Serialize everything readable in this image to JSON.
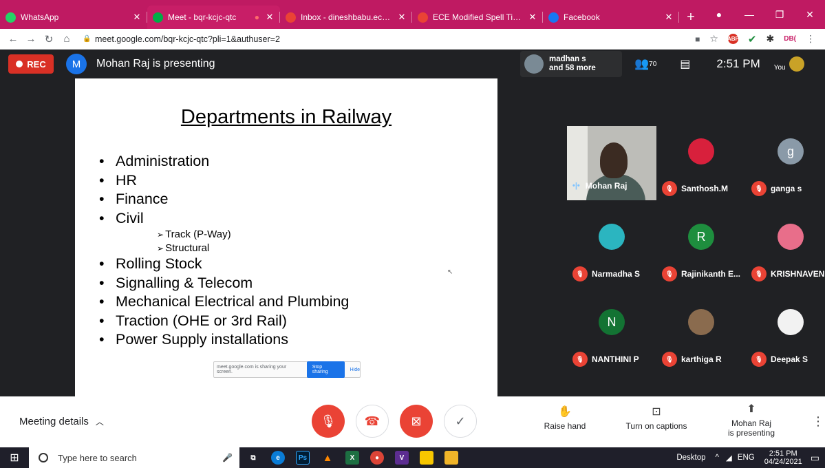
{
  "tabs": [
    {
      "label": "WhatsApp",
      "icon": "whatsapp-icon",
      "color": "#25d366"
    },
    {
      "label": "Meet - bqr-kcjc-qtc",
      "icon": "meet-icon",
      "color": "#00ac47"
    },
    {
      "label": "Inbox - dineshbabu.ece@adh",
      "icon": "gmail-icon",
      "color": "#ea4335"
    },
    {
      "label": "ECE Modified Spell Time Tabl",
      "icon": "gmail-icon",
      "color": "#ea4335"
    },
    {
      "label": "Facebook",
      "icon": "facebook-icon",
      "color": "#1877f2"
    }
  ],
  "address": {
    "url": "meet.google.com/bqr-kcjc-qtc?pli=1&authuser=2"
  },
  "meet": {
    "rec_label": "REC",
    "presenter_initial": "M",
    "presenting_text": "Mohan Raj is presenting",
    "participants_line1": "madhan s",
    "participants_line2": "and 58 more",
    "people_count": "70",
    "time": "2:51 PM",
    "you_label": "You"
  },
  "slide": {
    "title": "Departments in Railway",
    "items": [
      {
        "text": "Administration",
        "level": 1
      },
      {
        "text": "HR",
        "level": 1
      },
      {
        "text": "Finance",
        "level": 1
      },
      {
        "text": "Civil",
        "level": 1
      },
      {
        "text": "Track (P-Way)",
        "level": 2
      },
      {
        "text": "Structural",
        "level": 2
      },
      {
        "text": "Rolling Stock",
        "level": 1
      },
      {
        "text": "Signalling & Telecom",
        "level": 1
      },
      {
        "text": "Mechanical Electrical and Plumbing",
        "level": 1
      },
      {
        "text": "Traction (OHE or 3rd Rail)",
        "level": 1
      },
      {
        "text": "Power Supply installations",
        "level": 1
      }
    ],
    "share_text": "meet.google.com is sharing your screen.",
    "stop_label": "Stop sharing",
    "hide_label": "Hide"
  },
  "tiles": [
    {
      "name": "Mohan Raj",
      "video": true
    },
    {
      "name": "Santhosh.M",
      "avatar_color": "#d8203c"
    },
    {
      "name": "ganga s",
      "initial": "g",
      "avatar_color": "#8a9aa8"
    },
    {
      "name": "Narmadha S",
      "avatar_color": "#2bb5c0"
    },
    {
      "name": "Rajinikanth E...",
      "initial": "R",
      "avatar_color": "#1e8e3e"
    },
    {
      "name": "KRISHNAVEN...",
      "avatar_color": "#e86e8a"
    },
    {
      "name": "NANTHINI P",
      "initial": "N",
      "avatar_color": "#137333"
    },
    {
      "name": "karthiga R",
      "avatar_color": "#8a6b4e"
    },
    {
      "name": "Deepak S",
      "avatar_color": "#f2f2f2"
    }
  ],
  "bottom": {
    "meeting_details": "Meeting details",
    "raise_hand": "Raise hand",
    "captions": "Turn on captions",
    "presenting_line1": "Mohan Raj",
    "presenting_line2": "is presenting"
  },
  "taskbar": {
    "search_placeholder": "Type here to search",
    "desktop": "Desktop",
    "lang": "ENG",
    "time": "2:51 PM",
    "date": "04/24/2021"
  }
}
